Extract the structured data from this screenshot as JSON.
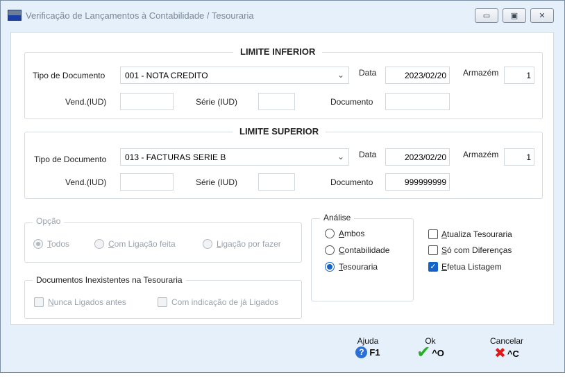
{
  "window": {
    "title": "Verificação de Lançamentos à Contabilidade / Tesouraria",
    "minimize_glyph": "▭",
    "maximize_glyph": "▣",
    "close_glyph": "✕"
  },
  "limite_inferior": {
    "title": "LIMITE INFERIOR",
    "tipo_label": "Tipo de Documento",
    "tipo_value": "001 - NOTA CREDITO",
    "data_label": "Data",
    "data_value": "2023/02/20",
    "armazem_label": "Armazém",
    "armazem_value": "1",
    "vend_label": "Vend.(IUD)",
    "vend_value": "",
    "serie_label": "Série (IUD)",
    "serie_value": "",
    "documento_label": "Documento",
    "documento_value": ""
  },
  "limite_superior": {
    "title": "LIMITE SUPERIOR",
    "tipo_label": "Tipo de Documento",
    "tipo_value": "013 - FACTURAS SERIE B",
    "data_label": "Data",
    "data_value": "2023/02/20",
    "armazem_label": "Armazém",
    "armazem_value": "1",
    "vend_label": "Vend.(IUD)",
    "vend_value": "",
    "serie_label": "Série (IUD)",
    "serie_value": "",
    "documento_label": "Documento",
    "documento_value": "999999999"
  },
  "opcao": {
    "title": "Opção",
    "todos_first": "T",
    "todos_rest": "odos",
    "com_ligacao_first": "C",
    "com_ligacao_rest": "om Ligação feita",
    "ligacao_first": "L",
    "ligacao_rest": "igação por fazer"
  },
  "inexistentes": {
    "title": "Documentos Inexistentes na Tesouraria",
    "nunca_first": "N",
    "nunca_rest": "unca Ligados antes",
    "com_indicacao": "Com indicação de já Ligados"
  },
  "analise": {
    "title": "Análise",
    "ambos_first": "A",
    "ambos_rest": "mbos",
    "contab_first": "C",
    "contab_rest": "ontabilidade",
    "tesouraria_first": "T",
    "tesouraria_rest": "esouraria"
  },
  "checks": {
    "atualiza_first": "A",
    "atualiza_rest": "tualiza Tesouraria",
    "so_first": "S",
    "so_rest": "ó com Diferenças",
    "efetua_first": "E",
    "efetua_rest": "fetua Listagem",
    "checkmark": "✓"
  },
  "actions": {
    "ajuda_label": "Ajuda",
    "ajuda_key": "F1",
    "ajuda_glyph": "?",
    "ok_label": "Ok",
    "ok_key": "^O",
    "ok_glyph": "✔",
    "cancelar_label": "Cancelar",
    "cancelar_key": "^C",
    "cancelar_glyph": "✖"
  },
  "colors": {
    "accent": "#1464c8",
    "ok_green": "#20b020",
    "cancel_red": "#e01818",
    "window_bg": "#e6f0fa"
  },
  "icons": [
    "app-icon",
    "minimize-icon",
    "maximize-icon",
    "close-icon",
    "chevron-down-icon",
    "help-icon",
    "checkmark-icon",
    "cross-icon"
  ]
}
